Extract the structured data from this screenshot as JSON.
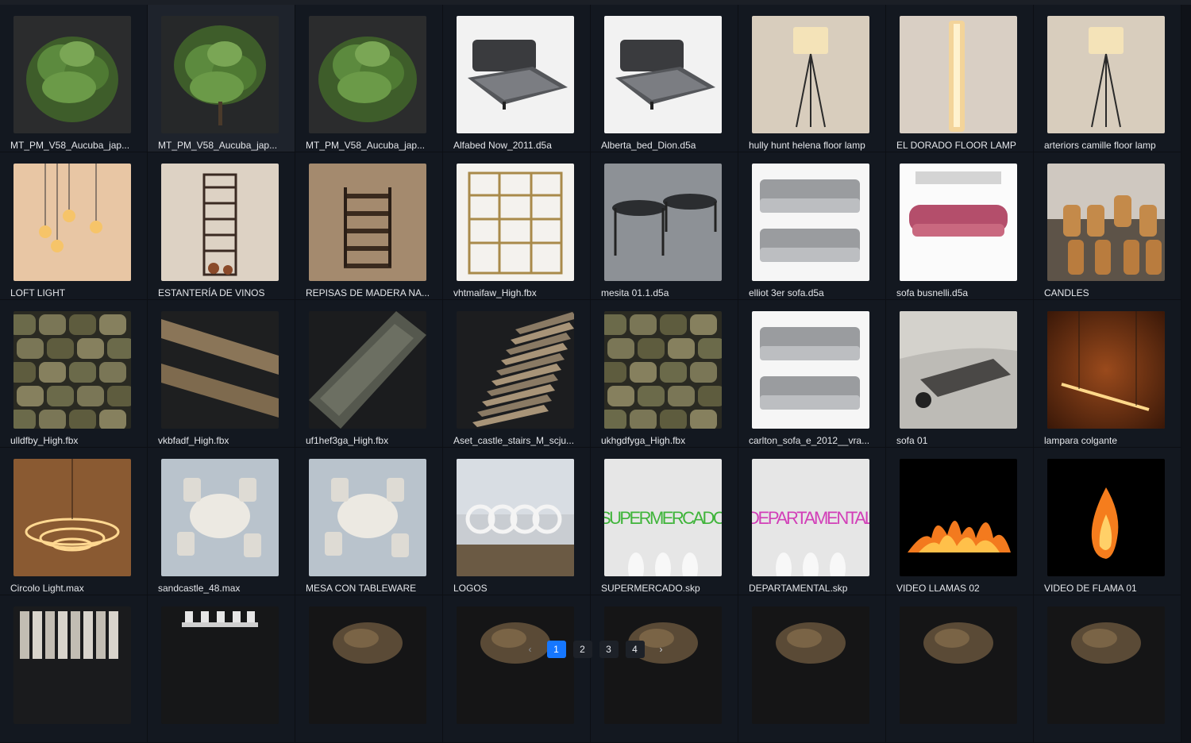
{
  "colors": {
    "background": "#0f1218",
    "card": "#131820",
    "card_selected": "#1e232c",
    "pager_active": "#1677ff"
  },
  "assets": [
    {
      "name": "MT_PM_V58_Aucuba_jap...",
      "thumb": "plant-dark-icon"
    },
    {
      "name": "MT_PM_V58_Aucuba_jap...",
      "thumb": "plant-tree-icon",
      "selected": true
    },
    {
      "name": "MT_PM_V58_Aucuba_jap...",
      "thumb": "plant-bush-icon"
    },
    {
      "name": "Alfabed Now_2011.d5a",
      "thumb": "bed-icon"
    },
    {
      "name": "Alberta_bed_Dion.d5a",
      "thumb": "bed-icon"
    },
    {
      "name": "hully hunt helena floor lamp",
      "thumb": "floor-lamp-icon"
    },
    {
      "name": "EL DORADO FLOOR LAMP",
      "thumb": "column-lamp-icon"
    },
    {
      "name": "arteriors camille floor lamp",
      "thumb": "floor-lamp-icon"
    },
    {
      "name": "LOFT LIGHT",
      "thumb": "pendant-bulbs-icon"
    },
    {
      "name": "ESTANTERÍA DE VINOS",
      "thumb": "wine-rack-icon"
    },
    {
      "name": "REPISAS DE MADERA NA...",
      "thumb": "wall-shelves-icon"
    },
    {
      "name": "vhtmaifaw_High.fbx",
      "thumb": "shelf-frame-icon"
    },
    {
      "name": "mesita 01.1.d5a",
      "thumb": "side-tables-icon"
    },
    {
      "name": "elliot 3er sofa.d5a",
      "thumb": "sofa-icon"
    },
    {
      "name": "sofa busnelli.d5a",
      "thumb": "sofa-pink-icon"
    },
    {
      "name": "CANDLES",
      "thumb": "candles-icon"
    },
    {
      "name": "ulldfby_High.fbx",
      "thumb": "stone-wall-icon"
    },
    {
      "name": "vkbfadf_High.fbx",
      "thumb": "wood-beams-icon"
    },
    {
      "name": "uf1hef3ga_High.fbx",
      "thumb": "stone-path-icon"
    },
    {
      "name": "Aset_castle_stairs_M_scju...",
      "thumb": "stairs-icon"
    },
    {
      "name": "ukhgdfyga_High.fbx",
      "thumb": "stone-wall-icon"
    },
    {
      "name": "carlton_sofa_e_2012__vra...",
      "thumb": "sofa-icon"
    },
    {
      "name": "sofa 01",
      "thumb": "daybed-icon"
    },
    {
      "name": "lampara colgante",
      "thumb": "linear-pendant-icon"
    },
    {
      "name": "Circolo Light.max",
      "thumb": "ring-chandelier-icon"
    },
    {
      "name": "sandcastle_48.max",
      "thumb": "dining-set-icon"
    },
    {
      "name": "MESA CON TABLEWARE",
      "thumb": "dining-set-icon"
    },
    {
      "name": "LOGOS",
      "thumb": "logo-rings-icon"
    },
    {
      "name": "SUPERMERCADO.skp",
      "thumb": "sign-text-icon",
      "sign_text": "SUPERMERCADO",
      "sign_color": "#3fb43a"
    },
    {
      "name": "DEPARTAMENTAL.skp",
      "thumb": "sign-text-icon",
      "sign_text": "DEPARTAMENTAL",
      "sign_color": "#d23fb8"
    },
    {
      "name": "VIDEO LLAMAS 02",
      "thumb": "fire-icon"
    },
    {
      "name": "VIDEO DE FLAMA 01",
      "thumb": "flame-icon"
    },
    {
      "name": "",
      "thumb": "curtain-icon"
    },
    {
      "name": "",
      "thumb": "tableware-icon"
    },
    {
      "name": "",
      "thumb": "rock-icon"
    },
    {
      "name": "",
      "thumb": "rock-icon"
    },
    {
      "name": "",
      "thumb": "rock-icon"
    },
    {
      "name": "",
      "thumb": "rock-icon"
    },
    {
      "name": "",
      "thumb": "rock-icon"
    },
    {
      "name": "",
      "thumb": "rock-icon"
    }
  ],
  "pagination": {
    "prev_label": "‹",
    "next_label": "›",
    "pages": [
      "1",
      "2",
      "3",
      "4"
    ],
    "current": "1"
  }
}
